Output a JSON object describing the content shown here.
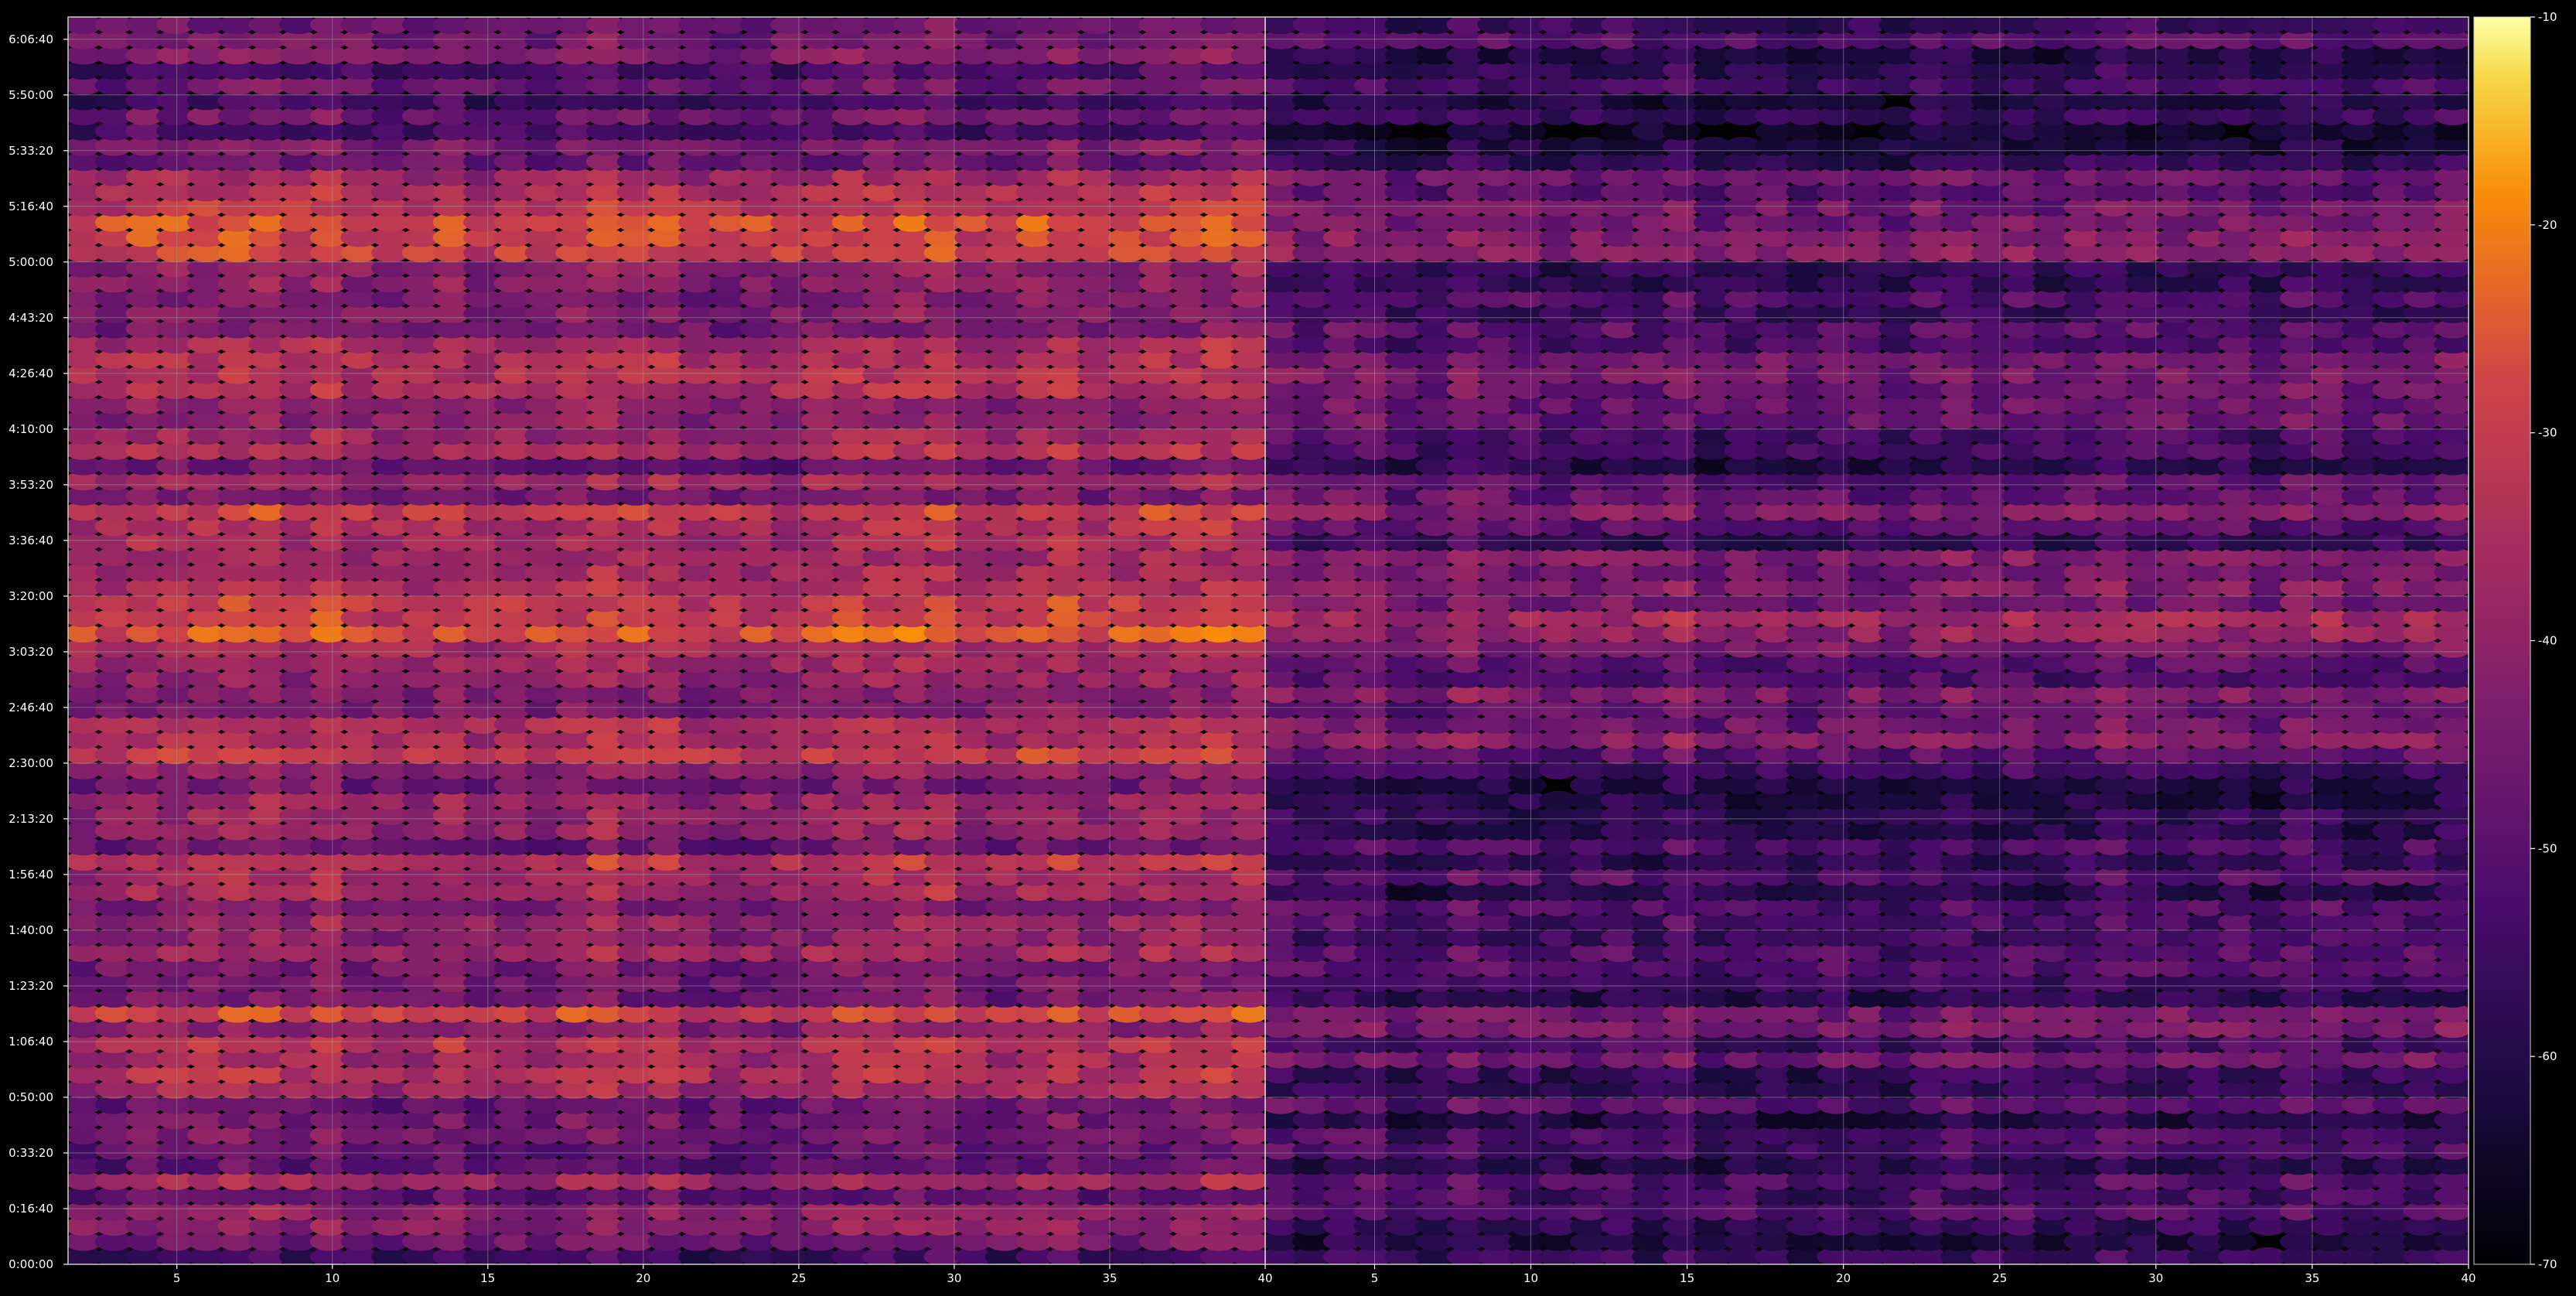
{
  "chart_data": {
    "type": "heatmap",
    "colormap": "inferno",
    "background_color": "#000000",
    "text_color": "#ffffff",
    "grid": true,
    "grid_color": "#9a9a9a",
    "colorbar": {
      "position": "right",
      "range": [
        -70,
        -10
      ],
      "ticks": [
        -10,
        -20,
        -30,
        -40,
        -50,
        -60,
        -70
      ],
      "tick_labels": [
        "-10",
        "-20",
        "-30",
        "-40",
        "-50",
        "-60",
        "-70"
      ]
    },
    "y_axis": {
      "range_seconds": [
        0,
        22400
      ],
      "ticks_seconds": [
        0,
        1000,
        2000,
        3000,
        4000,
        5000,
        6000,
        7000,
        8000,
        9000,
        10000,
        11000,
        12000,
        13000,
        14000,
        15000,
        16000,
        17000,
        18000,
        19000,
        20000,
        21000,
        22000,
        23000,
        24000
      ],
      "tick_labels": [
        "0:00:00",
        "0:16:40",
        "0:33:20",
        "0:50:00",
        "1:06:40",
        "1:23:20",
        "1:40:00",
        "1:56:40",
        "2:13:20",
        "2:30:00",
        "2:46:40",
        "3:03:20",
        "3:20:00",
        "3:36:40",
        "3:53:20",
        "4:10:00",
        "4:26:40",
        "4:43:20",
        "5:00:00",
        "5:16:40",
        "5:33:20",
        "5:50:00",
        "6:06:40"
      ]
    },
    "panels": [
      {
        "name": "left",
        "x_range": [
          1.5,
          40
        ],
        "x_ticks": [
          5,
          10,
          15,
          20,
          25,
          30,
          35,
          40
        ],
        "x_tick_labels": [
          "5",
          "10",
          "15",
          "20",
          "25",
          "30",
          "35",
          "40"
        ],
        "channels": 39,
        "level_baseline_db": -44
      },
      {
        "name": "right",
        "x_range": [
          1.5,
          40
        ],
        "x_ticks": [
          5,
          10,
          15,
          20,
          25,
          30,
          35,
          40
        ],
        "x_tick_labels": [
          "5",
          "10",
          "15",
          "20",
          "25",
          "30",
          "35",
          "40"
        ],
        "channels": 39,
        "level_baseline_db": -56
      }
    ],
    "time_bands_db": [
      {
        "t": 0,
        "db": -52
      },
      {
        "t": 500,
        "db": -48
      },
      {
        "t": 1500,
        "db": -42
      },
      {
        "t": 3000,
        "db": -44
      },
      {
        "t": 3500,
        "db": -38
      },
      {
        "t": 4500,
        "db": -34
      },
      {
        "t": 5000,
        "db": -46
      },
      {
        "t": 6000,
        "db": -40
      },
      {
        "t": 6500,
        "db": -44
      },
      {
        "t": 7000,
        "db": -36
      },
      {
        "t": 7500,
        "db": -42
      },
      {
        "t": 8000,
        "db": -38
      },
      {
        "t": 8500,
        "db": -48
      },
      {
        "t": 9000,
        "db": -36
      },
      {
        "t": 10500,
        "db": -38
      },
      {
        "t": 11500,
        "db": -26
      },
      {
        "t": 12000,
        "db": -28
      },
      {
        "t": 12500,
        "db": -30
      },
      {
        "t": 13000,
        "db": -40
      },
      {
        "t": 13500,
        "db": -34
      },
      {
        "t": 14000,
        "db": -44
      },
      {
        "t": 15500,
        "db": -36
      },
      {
        "t": 16500,
        "db": -40
      },
      {
        "t": 17000,
        "db": -38
      },
      {
        "t": 17500,
        "db": -42
      },
      {
        "t": 18500,
        "db": -32
      },
      {
        "t": 19500,
        "db": -36
      },
      {
        "t": 20000,
        "db": -44
      },
      {
        "t": 20500,
        "db": -50
      },
      {
        "t": 21500,
        "db": -46
      },
      {
        "t": 22000,
        "db": -42
      }
    ],
    "title": "",
    "xlabel": "",
    "ylabel": ""
  }
}
